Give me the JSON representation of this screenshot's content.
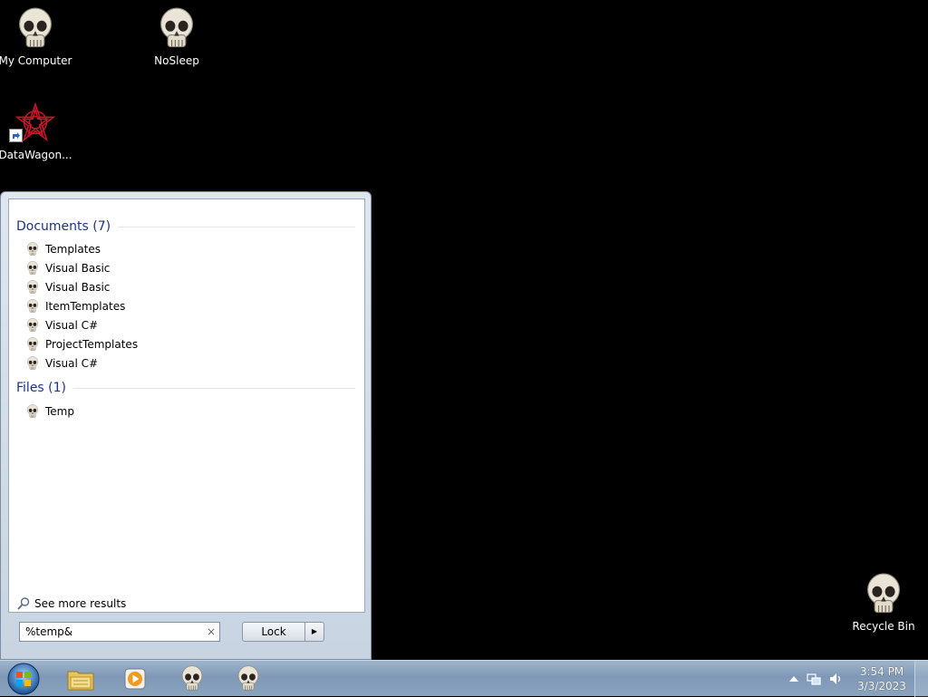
{
  "desktop": {
    "icons": [
      {
        "label": "My Computer",
        "icon": "skull-icon"
      },
      {
        "label": "NoSleep",
        "icon": "skull-icon"
      },
      {
        "label": "DataWagon...",
        "icon": "red-star-app-icon"
      },
      {
        "label": "Recycle Bin",
        "icon": "skull-icon"
      }
    ]
  },
  "start_menu": {
    "groups": [
      {
        "title": "Documents (7)",
        "items": [
          "Templates",
          "Visual Basic",
          "Visual Basic",
          "ItemTemplates",
          "Visual C#",
          "ProjectTemplates",
          "Visual C#"
        ]
      },
      {
        "title": "Files (1)",
        "items": [
          "Temp"
        ]
      }
    ],
    "see_more": "See more results",
    "search": {
      "value": "%temp&",
      "clear_glyph": "×"
    },
    "lock_label": "Lock",
    "lock_arrow": "▶"
  },
  "taskbar": {
    "pinned": [
      {
        "name": "start-orb",
        "icon": "windows-orb-icon"
      },
      {
        "name": "file-explorer",
        "icon": "folder-icon"
      },
      {
        "name": "media-player",
        "icon": "media-player-icon"
      },
      {
        "name": "skull-app-1",
        "icon": "skull-icon"
      },
      {
        "name": "skull-app-2",
        "icon": "skull-icon"
      }
    ],
    "tray": {
      "time": "3:54 PM",
      "date": "3/3/2023"
    }
  },
  "colors": {
    "desktop_bg": "#000000",
    "group_header": "#1e3287",
    "taskbar": "#8aa3bf"
  }
}
